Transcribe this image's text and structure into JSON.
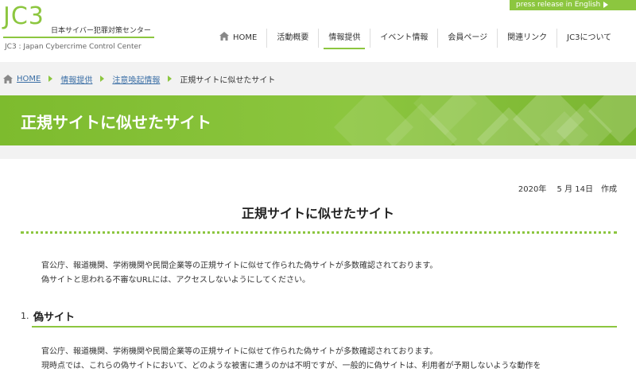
{
  "logo": {
    "mark": "JC3",
    "jp": "日本サイバー犯罪対策センター",
    "en": "JC3 : Japan Cybercrime Control Center"
  },
  "press_release": "press release in English",
  "nav": [
    {
      "label": "HOME",
      "icon": "home-icon"
    },
    {
      "label": "活動概要"
    },
    {
      "label": "情報提供",
      "active": true
    },
    {
      "label": "イベント情報"
    },
    {
      "label": "会員ページ"
    },
    {
      "label": "関連リンク"
    },
    {
      "label": "JC3について"
    }
  ],
  "breadcrumb": {
    "home": "HOME",
    "level1": "情報提供",
    "level2": "注意喚起情報",
    "current": "正規サイトに似せたサイト"
  },
  "banner": {
    "title": "正規サイトに似せたサイト"
  },
  "content": {
    "date": "2020年　 5 月 14日　作成",
    "title": "正規サイトに似せたサイト",
    "intro": [
      "官公庁、報道機関、学術機関や民間企業等の正規サイトに似せて作られた偽サイトが多数確認されております。",
      "偽サイトと思われる不審なURLには、アクセスしないようにしてください。"
    ],
    "section1": {
      "number": "1.",
      "title": "偽サイト",
      "body": [
        "官公庁、報道機関、学術機関や民間企業等の正規サイトに似せて作られた偽サイトが多数確認されております。",
        "現時点では、これらの偽サイトにおいて、どのような被害に遭うのかは不明ですが、一般的に偽サイトは、利用者が予期しないような動作を"
      ]
    }
  },
  "colors": {
    "accent": "#8cc63f",
    "link": "#3a6ea5",
    "background": "#f2f2f2"
  }
}
